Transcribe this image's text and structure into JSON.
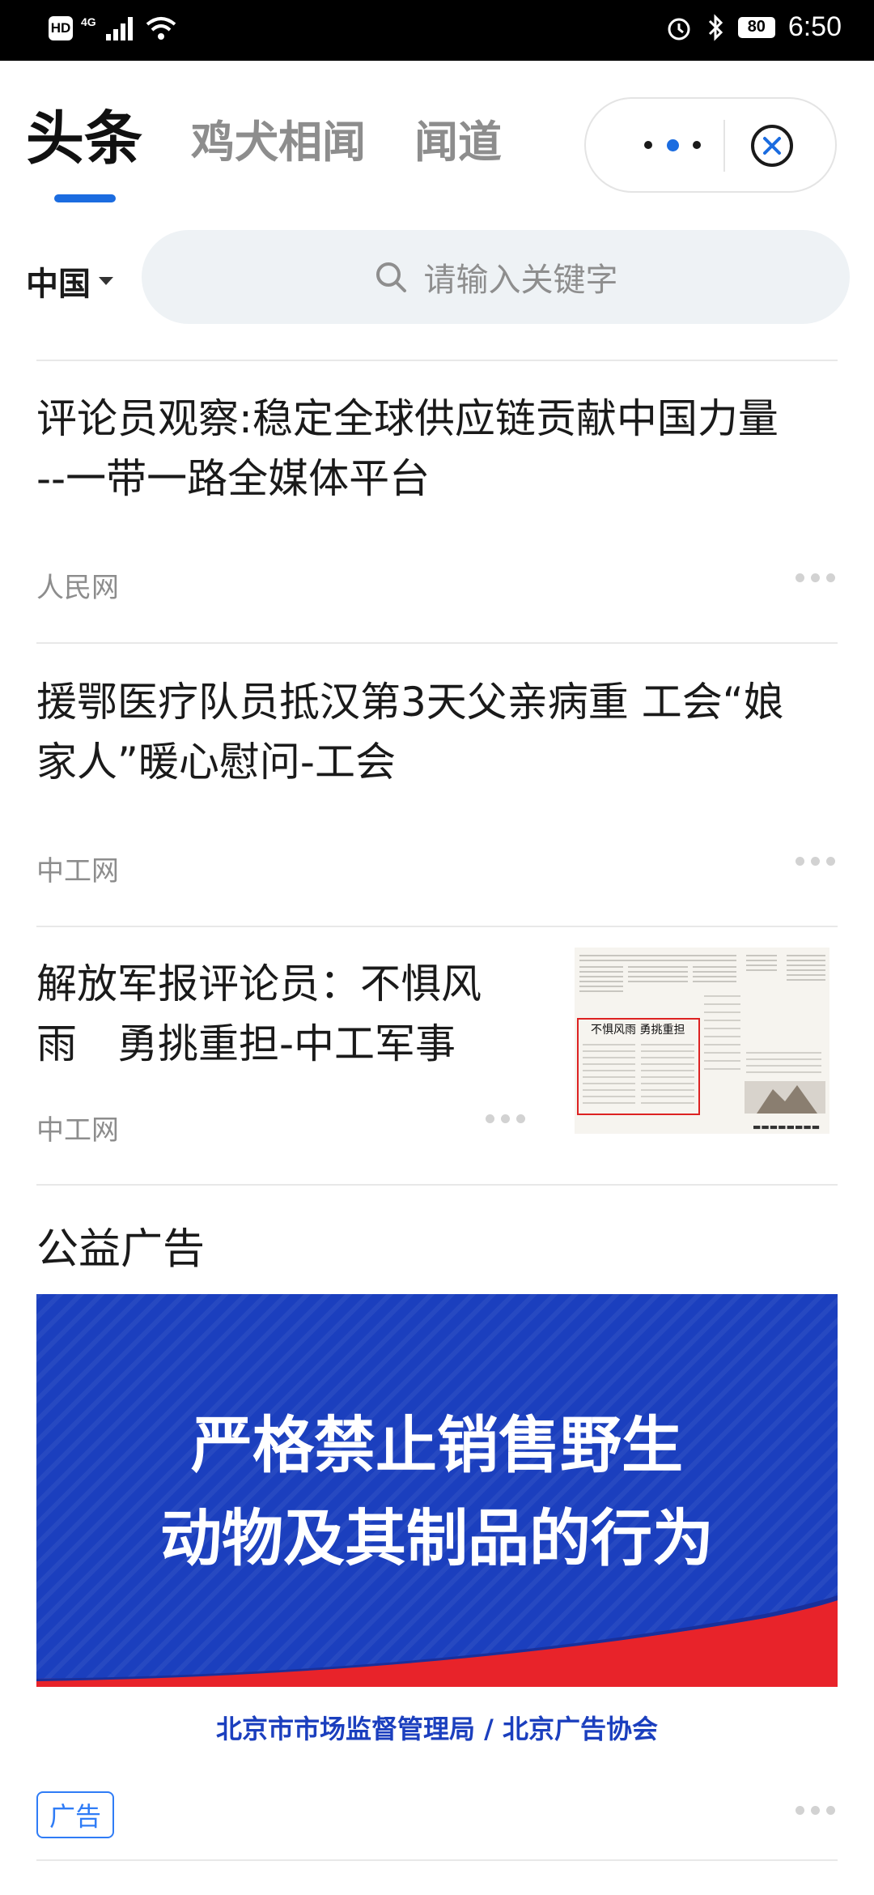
{
  "status_bar": {
    "hd": "HD",
    "network": "4G",
    "battery": "80",
    "time": "6:50"
  },
  "header": {
    "tabs": [
      {
        "label": "头条",
        "active": true
      },
      {
        "label": "鸡犬相闻",
        "active": false
      },
      {
        "label": "闻道",
        "active": false
      }
    ],
    "accent_color": "#1b6ce0"
  },
  "filter": {
    "region": "中国",
    "search_placeholder": "请输入关键字"
  },
  "articles": [
    {
      "title_line1": "评论员观察:稳定全球供应链贡献中国力量",
      "title_line2": "--一带一路全媒体平台",
      "source": "人民网"
    },
    {
      "title_line1": "援鄂医疗队员抵汉第3天父亲病重 工会“娘",
      "title_line2": "家人”暖心慰问-工会",
      "source": "中工网"
    },
    {
      "title_line1": "解放军报评论员：不惧风",
      "title_line2": "雨　勇挑重担-中工军事",
      "source": "中工网",
      "thumbnail": "newspaper-thumbnail"
    }
  ],
  "ad_section": {
    "label": "公益广告",
    "banner_line1": "严格禁止销售野生",
    "banner_line2": "动物及其制品的行为",
    "organizations": "北京市市场监督管理局 / 北京广告协会",
    "tag": "广告",
    "banner_color": "#1b3fbe",
    "ribbon_color": "#e8232a"
  }
}
